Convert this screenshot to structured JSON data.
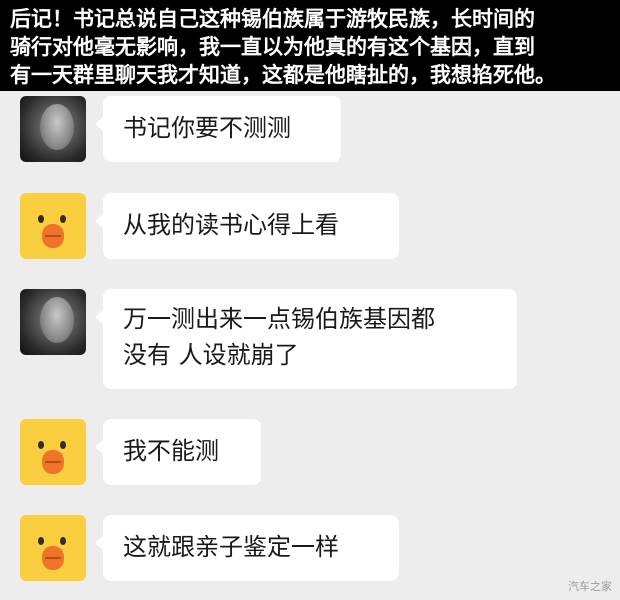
{
  "banner": {
    "line1": "后记！书记总说自己这种锡伯族属于游牧民族，长时间的",
    "line2": "骑行对他毫无影响，我一直以为他真的有这个基因，直到",
    "line3": "有一天群里聊天我才知道，这都是他瞎扯的，我想掐死他。"
  },
  "messages": [
    {
      "avatar": "photo-avatar",
      "text": "书记你要不测测"
    },
    {
      "avatar": "duck-avatar",
      "text": "从我的读书心得上看"
    },
    {
      "avatar": "photo-avatar",
      "line1": "万一测出来一点锡伯族基因都",
      "line2": "没有 人设就崩了"
    },
    {
      "avatar": "duck-avatar",
      "text": "我不能测"
    },
    {
      "avatar": "duck-avatar",
      "text": "这就跟亲子鉴定一样"
    }
  ],
  "watermark": "汽车之家"
}
